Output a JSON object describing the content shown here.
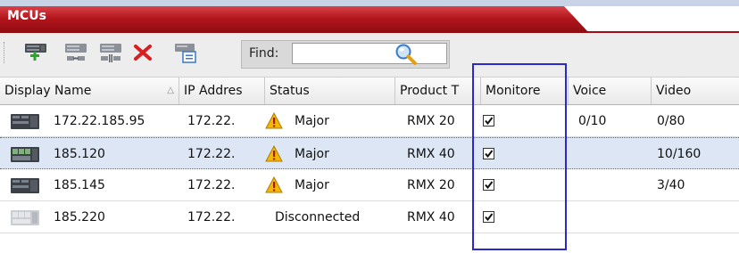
{
  "window": {
    "title": "MCUs"
  },
  "toolbar": {
    "buttons": [
      {
        "icon": "add-mcu-icon"
      },
      {
        "icon": "connect-mcu-icon"
      },
      {
        "icon": "disconnect-mcu-icon"
      },
      {
        "icon": "delete-icon"
      },
      {
        "icon": "mcu-properties-icon"
      }
    ],
    "find_label": "Find:",
    "find_value": "",
    "search_icon": "search-icon"
  },
  "table": {
    "columns": [
      "Display Name",
      "IP Addres",
      "Status",
      "Product T",
      "Monitore",
      "Voice",
      "Video"
    ],
    "sort_indicator": "△",
    "rows": [
      {
        "display_name": "172.22.185.95",
        "ip": "172.22.",
        "status": "Major",
        "status_icon": "warning-icon",
        "product": "RMX 20",
        "monitored": true,
        "voice": "0/10",
        "video": "0/80",
        "device_icon": "mcu-rmx2000-icon",
        "selected": false
      },
      {
        "display_name": "185.120",
        "ip": "172.22.",
        "status": "Major",
        "status_icon": "warning-icon",
        "product": "RMX 40",
        "monitored": true,
        "voice": "",
        "video": "10/160",
        "device_icon": "mcu-rmx4000-icon",
        "selected": true
      },
      {
        "display_name": "185.145",
        "ip": "172.22.",
        "status": "Major",
        "status_icon": "warning-icon",
        "product": "RMX 20",
        "monitored": true,
        "voice": "",
        "video": "3/40",
        "device_icon": "mcu-rmx2000-icon",
        "selected": false
      },
      {
        "display_name": "185.220",
        "ip": "172.22.",
        "status": "Disconnected",
        "status_icon": "",
        "product": "RMX 40",
        "monitored": true,
        "voice": "",
        "video": "",
        "device_icon": "mcu-disconnected-icon",
        "selected": false
      }
    ]
  },
  "colors": {
    "title_red": "#b3161c",
    "selection": "#dde6f5",
    "highlight_box": "#2a2acc",
    "warning": "#f2b707"
  }
}
